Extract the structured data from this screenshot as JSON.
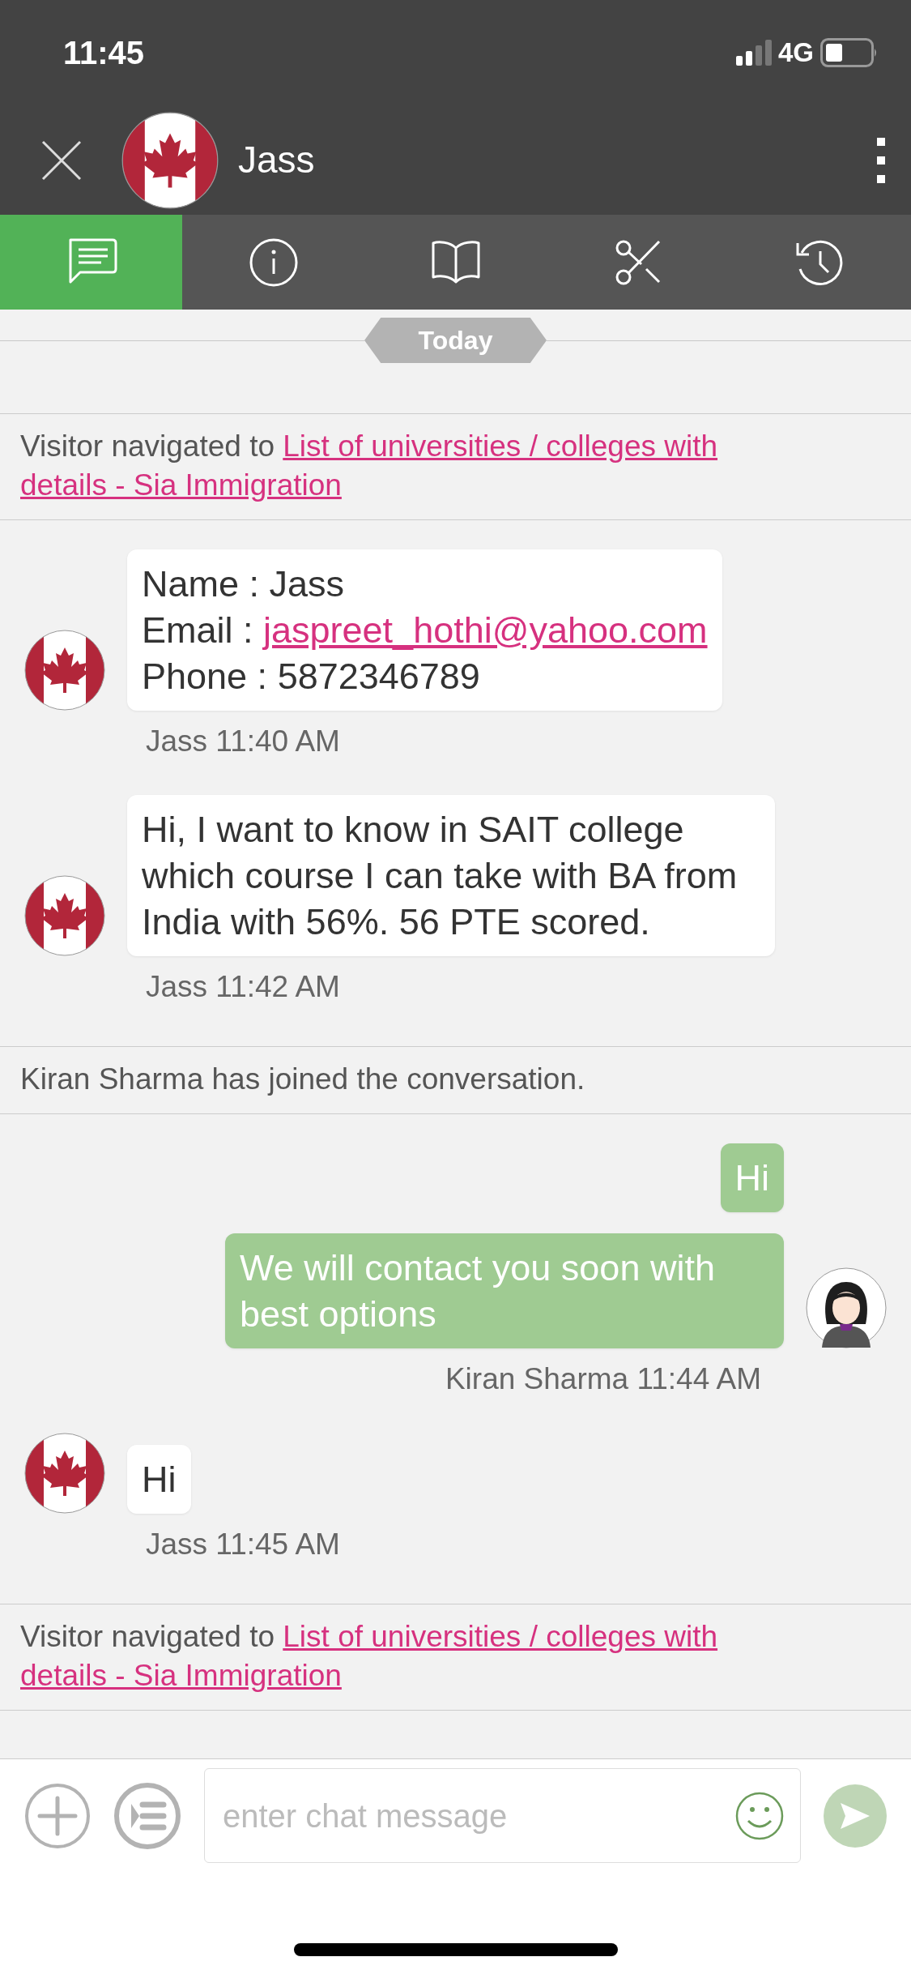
{
  "status_bar": {
    "time": "11:45",
    "network": "4G"
  },
  "header": {
    "title": "Jass"
  },
  "tabs": [
    {
      "kind": "chat",
      "selected": true
    },
    {
      "kind": "info",
      "selected": false
    },
    {
      "kind": "book",
      "selected": false
    },
    {
      "kind": "scissors",
      "selected": false
    },
    {
      "kind": "history",
      "selected": false
    }
  ],
  "date_separator": "Today",
  "messages": [
    {
      "kind": "notice",
      "text": "Visitor navigated to ",
      "link": "List of universities / colleges with details - Sia Immigration"
    },
    {
      "kind": "incoming",
      "lines": [
        {
          "text": "Name : Jass"
        },
        {
          "text": "Email : ",
          "link": "jaspreet_hothi@yahoo.com"
        },
        {
          "text": "Phone : 5872346789"
        }
      ],
      "meta": "Jass 11:40 AM"
    },
    {
      "kind": "incoming",
      "lines": [
        {
          "text": "Hi, I want to know in SAIT college which course I can take with BA from India with 56%. 56 PTE scored."
        }
      ],
      "meta": "Jass 11:42 AM"
    },
    {
      "kind": "system",
      "text": "Kiran Sharma has joined the conversation."
    },
    {
      "kind": "outgoing",
      "lines": [
        {
          "text": "Hi"
        }
      ],
      "avatar": false
    },
    {
      "kind": "outgoing",
      "lines": [
        {
          "text": "We will contact you soon with best options"
        }
      ],
      "avatar": true,
      "meta": "Kiran Sharma 11:44 AM"
    },
    {
      "kind": "incoming",
      "lines": [
        {
          "text": "Hi"
        }
      ],
      "meta": "Jass 11:45 AM"
    },
    {
      "kind": "notice",
      "text": "Visitor navigated to ",
      "link": "List of universities / colleges with details - Sia Immigration"
    }
  ],
  "composer": {
    "placeholder": "enter chat message"
  }
}
